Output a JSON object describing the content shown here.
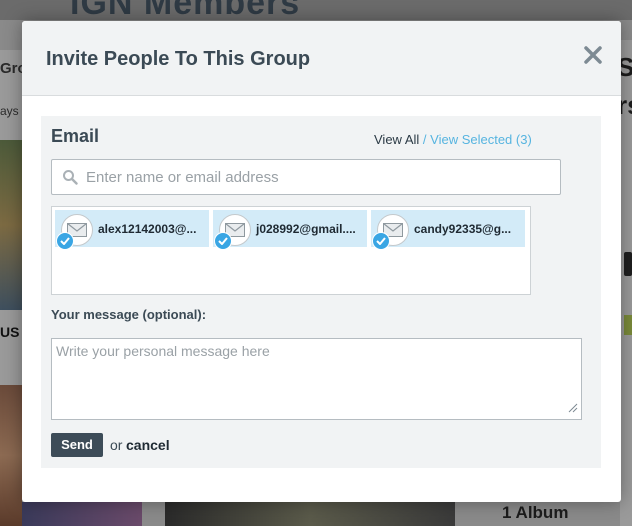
{
  "background": {
    "heading": "IGN Members",
    "left_text_1": "Gro",
    "left_text_2": "ays",
    "left_text_3": "US",
    "right_text_1": "S",
    "right_text_2": "rs",
    "bottom_text": "1 Album"
  },
  "modal": {
    "title": "Invite People To This Group",
    "close_icon": "close-icon",
    "email_label": "Email",
    "view_all": "View All",
    "view_separator": " / ",
    "view_selected": "View Selected (3)",
    "search": {
      "placeholder": "Enter name or email address",
      "value": ""
    },
    "recipients": [
      {
        "label": "alex12142003@...",
        "icon": "mail-icon",
        "selected": true
      },
      {
        "label": "j028992@gmail....",
        "icon": "mail-icon",
        "selected": true
      },
      {
        "label": "candy92335@g...",
        "icon": "mail-icon",
        "selected": true
      }
    ],
    "message_label": "Your message (optional):",
    "message": {
      "placeholder": "Write your personal message here",
      "value": ""
    },
    "send_label": "Send",
    "or_text": "or",
    "cancel_label": "cancel"
  },
  "colors": {
    "accent_link": "#56b4e0",
    "chip_bg": "#d3ebf8",
    "check": "#3aa6e4",
    "send_bg": "#3d4c58"
  }
}
